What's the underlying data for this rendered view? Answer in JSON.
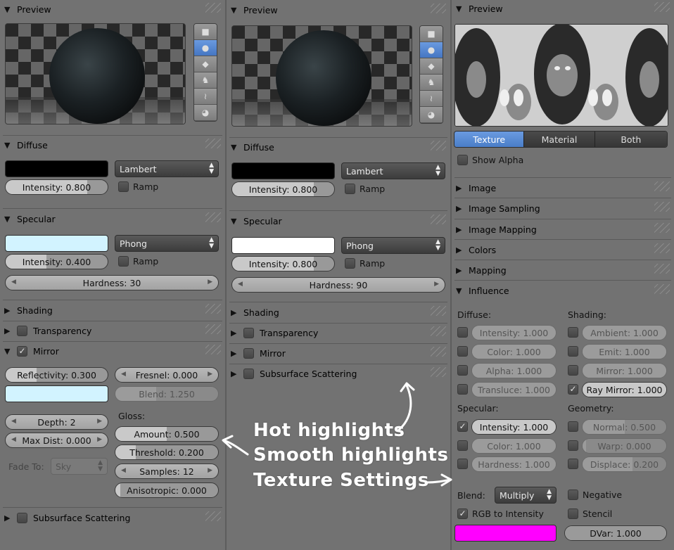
{
  "col1": {
    "preview_title": "Preview",
    "diffuse_title": "Diffuse",
    "diffuse_color": "#000000",
    "diffuse_shader": "Lambert",
    "diffuse_intensity": "Intensity: 0.800",
    "diffuse_intensity_value": 0.8,
    "diffuse_ramp": "Ramp",
    "specular_title": "Specular",
    "specular_color": "#d2f3ff",
    "specular_shader": "Phong",
    "specular_intensity": "Intensity: 0.400",
    "specular_intensity_value": 0.4,
    "specular_ramp": "Ramp",
    "hardness": "Hardness: 30",
    "shading": "Shading",
    "transparency": "Transparency",
    "mirror": "Mirror",
    "reflectivity": "Reflectivity: 0.300",
    "reflectivity_value": 0.3,
    "fresnel": "Fresnel: 0.000",
    "blend": "Blend: 1.250",
    "mirror_color": "#d2f3ff",
    "depth": "Depth: 2",
    "max_dist": "Max Dist: 0.000",
    "gloss_label": "Gloss:",
    "amount": "Amount: 0.500",
    "amount_value": 0.5,
    "threshold": "Threshold: 0.200",
    "threshold_value": 0.2,
    "samples": "Samples: 12",
    "anisotropic": "Anisotropic: 0.000",
    "fade_to_label": "Fade To:",
    "fade_to_value": "Sky",
    "sss": "Subsurface Scattering"
  },
  "col2": {
    "preview_title": "Preview",
    "diffuse_title": "Diffuse",
    "diffuse_color": "#000000",
    "diffuse_shader": "Lambert",
    "diffuse_intensity": "Intensity: 0.800",
    "diffuse_intensity_value": 0.8,
    "diffuse_ramp": "Ramp",
    "specular_title": "Specular",
    "specular_color": "#ffffff",
    "specular_shader": "Phong",
    "specular_intensity": "Intensity: 0.800",
    "specular_intensity_value": 0.8,
    "specular_ramp": "Ramp",
    "hardness": "Hardness: 90",
    "shading": "Shading",
    "transparency": "Transparency",
    "mirror": "Mirror",
    "sss": "Subsurface Scattering"
  },
  "col3": {
    "preview_title": "Preview",
    "tabs": [
      "Texture",
      "Material",
      "Both"
    ],
    "show_alpha": "Show Alpha",
    "panels": [
      "Image",
      "Image Sampling",
      "Image Mapping",
      "Colors",
      "Mapping"
    ],
    "influence": "Influence",
    "diffuse_label": "Diffuse:",
    "shading_label": "Shading:",
    "specular_label": "Specular:",
    "geometry_label": "Geometry:",
    "d_intensity": "Intensity: 1.000",
    "d_color": "Color: 1.000",
    "d_alpha": "Alpha: 1.000",
    "d_transluce": "Transluce: 1.000",
    "s_ambient": "Ambient: 1.000",
    "s_emit": "Emit: 1.000",
    "s_mirror": "Mirror: 1.000",
    "s_raymirror": "Ray Mirror: 1.000",
    "sp_intensity": "Intensity: 1.000",
    "sp_color": "Color: 1.000",
    "sp_hardness": "Hardness: 1.000",
    "g_normal": "Normal: 0.500",
    "g_warp": "Warp: 0.000",
    "g_displace": "Displace: 0.200",
    "blend_label": "Blend:",
    "blend_value": "Multiply",
    "negative": "Negative",
    "rgb_to_intensity": "RGB to Intensity",
    "stencil": "Stencil",
    "dvar": "DVar: 1.000",
    "tint_color": "#ff00ff"
  },
  "annotations": {
    "hot": "Hot highlights",
    "smooth": "Smooth highlights",
    "texture": "Texture Settings"
  },
  "icons": [
    "triangle-down-icon",
    "triangle-right-icon",
    "plane-icon",
    "sphere-icon",
    "cube-icon",
    "monkey-icon",
    "hair-icon",
    "sky-icon",
    "checkmark-icon",
    "arrow-icon"
  ],
  "colors": {
    "accent": "#4a7ec8",
    "panel": "#727272",
    "magenta": "#ff00ff"
  }
}
